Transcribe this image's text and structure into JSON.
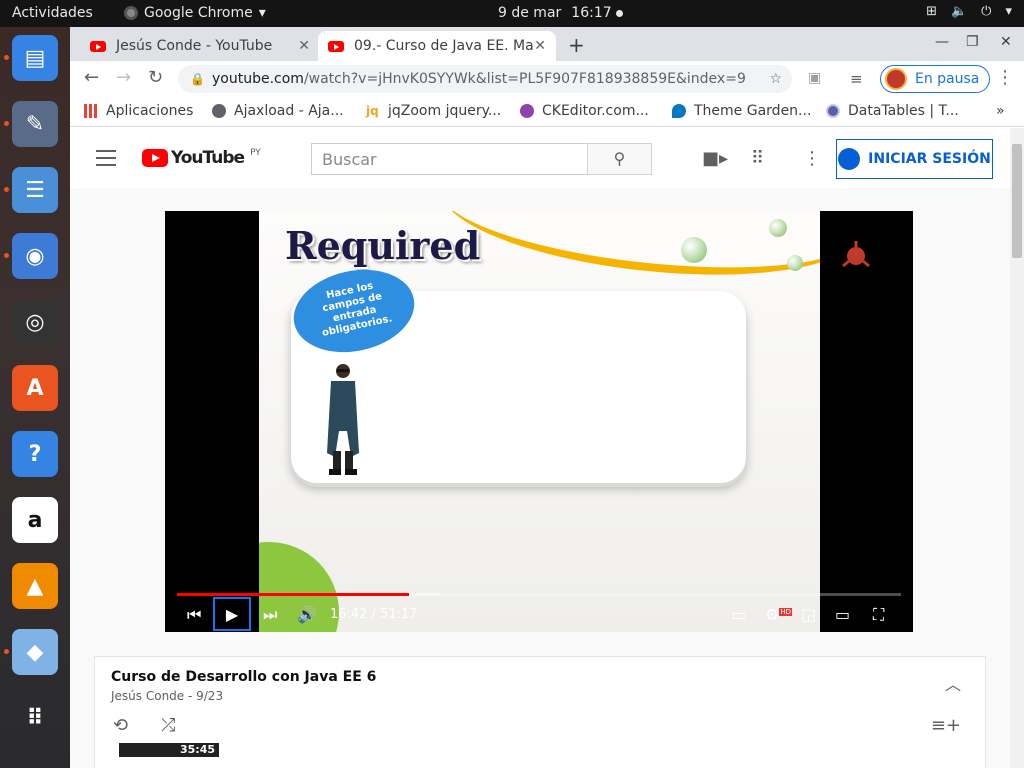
{
  "topbar": {
    "activities": "Actividades",
    "app_menu": "Google Chrome",
    "app_menu_arrow": "▾",
    "date": "9 de mar",
    "time": "16:17",
    "network_icon": "network-icon",
    "volume_icon": "volume-icon",
    "power_icon": "power-icon"
  },
  "dock": {
    "items": [
      {
        "name": "text-editor-icon",
        "glyph": "▤",
        "color": "#3584e4",
        "running": true
      },
      {
        "name": "paint-brush-icon",
        "glyph": "✎",
        "color": "#5a6b8a",
        "running": true
      },
      {
        "name": "file-cabinet-icon",
        "glyph": "☰",
        "color": "#4a90d9",
        "running": true
      },
      {
        "name": "chromium-icon",
        "glyph": "◉",
        "color": "#3d7bd6",
        "running": true
      },
      {
        "name": "speaker-icon",
        "glyph": "◎",
        "color": "#333",
        "running": false
      },
      {
        "name": "software-store-icon",
        "glyph": "A",
        "color": "#e95420",
        "running": false
      },
      {
        "name": "help-icon",
        "glyph": "?",
        "color": "#3584e4",
        "running": false
      },
      {
        "name": "amazon-icon",
        "glyph": "a",
        "color": "#ffffff",
        "running": false
      },
      {
        "name": "vlc-icon",
        "glyph": "▲",
        "color": "#f08a00",
        "running": false
      },
      {
        "name": "virtualbox-icon",
        "glyph": "◆",
        "color": "#7fb2e5",
        "running": true
      },
      {
        "name": "show-apps-icon",
        "glyph": "⠿",
        "color": "transparent",
        "running": false
      }
    ]
  },
  "browser": {
    "tabs": [
      {
        "title": "Jesús Conde - YouTube",
        "close": "✕",
        "active": false
      },
      {
        "title": "09.- Curso de Java EE. Ma",
        "close": "✕",
        "active": true
      }
    ],
    "new_tab": "+",
    "window_controls": {
      "minimize": "—",
      "restore": "❐",
      "close": "✕"
    },
    "url_host": "youtube.com",
    "url_path": "/watch?v=jHnvK0SYYWk&list=PL5F907F818938859E&index=9",
    "profile_label": "En pausa",
    "bookmarks": [
      {
        "label": "Aplicaciones",
        "icon": "apps-grid-icon",
        "color": "#ea4335"
      },
      {
        "label": "Ajaxload - Aja...",
        "icon": "globe-icon",
        "color": "#5f6368"
      },
      {
        "label": "jqZoom jquery...",
        "icon": "jq-icon",
        "color": "#f5a623"
      },
      {
        "label": "CKEditor.com...",
        "icon": "ckeditor-icon",
        "color": "#8e44ad"
      },
      {
        "label": "Theme Garden...",
        "icon": "drupal-icon",
        "color": "#0678be"
      },
      {
        "label": "DataTables | T...",
        "icon": "datatables-icon",
        "color": "#5b5ea6"
      }
    ],
    "bookmarks_overflow": "»"
  },
  "youtube": {
    "logo_text": "YouTube",
    "region": "PY",
    "search_placeholder": "Buscar",
    "signin_label": "INICIAR SESIÓN",
    "video": {
      "slide_title": "Required",
      "bubble_lines": [
        "Hace los",
        "campos de",
        "entrada",
        "obligatorios."
      ],
      "current_time": "16:42",
      "duration": "51:17",
      "time_display": "16:42 / 51:17",
      "progress_fraction": 0.321,
      "hd_badge": "HD"
    },
    "playlist": {
      "title": "Curso de Desarrollo con Java EE 6",
      "subtitle": "Jesús Conde - 9/23",
      "first_thumb_duration": "35:45"
    }
  }
}
